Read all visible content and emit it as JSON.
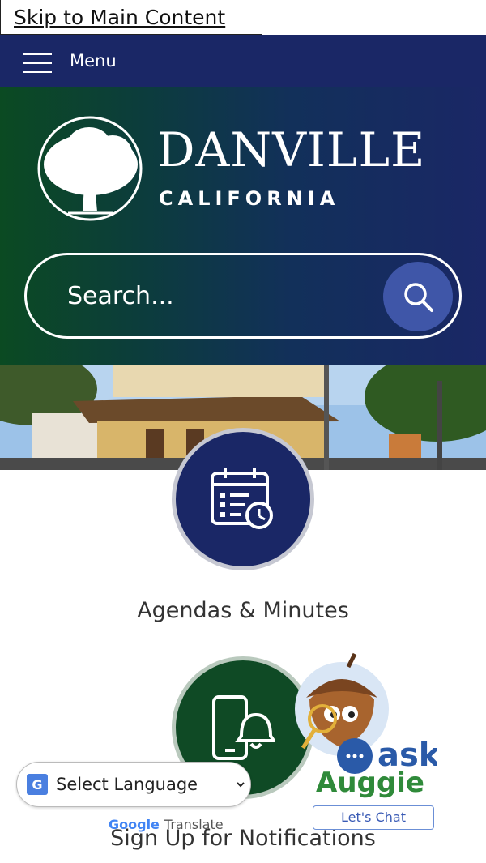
{
  "skip_link": {
    "label": "Skip to Main Content"
  },
  "nav": {
    "menu_label": "Menu"
  },
  "logo": {
    "name": "DANVILLE",
    "state": "CALIFORNIA"
  },
  "search": {
    "placeholder": "Search..."
  },
  "features": [
    {
      "label": "Agendas & Minutes",
      "icon": "calendar-clock-icon"
    },
    {
      "label": "Sign Up for Notifications",
      "icon": "phone-bell-icon"
    }
  ],
  "translate": {
    "select_label": "Select Language",
    "powered_google": "Google",
    "powered_translate": "Translate"
  },
  "chatbot": {
    "brand_ask": "ask",
    "brand_name": "Auggie",
    "chat_label": "Let's Chat"
  },
  "colors": {
    "nav_bg": "#1a2766",
    "header_green": "#0b4a22",
    "search_button": "#3f56a8",
    "notify_circle": "#0f4a25"
  }
}
